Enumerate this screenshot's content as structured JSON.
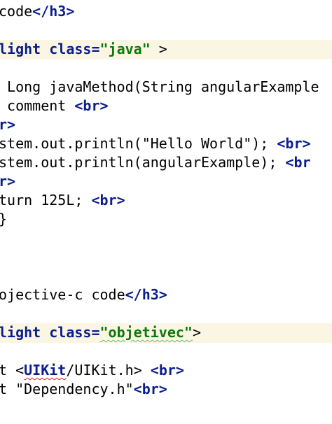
{
  "editor": {
    "lines": {
      "l1": {
        "text": "code",
        "close_tag": "</h3>"
      },
      "l2": {
        "kw": "light",
        "attr": "class=",
        "val": "\"java\"",
        "rest": " >"
      },
      "l3": {
        "text": " Long javaMethod(String angularExample"
      },
      "l4": {
        "text": " comment ",
        "tag": "<br>"
      },
      "l5": {
        "tag": "r>"
      },
      "l6": {
        "text": "stem.out.println(\"Hello World\"); ",
        "tag": "<br>"
      },
      "l7": {
        "text": "stem.out.println(angularExample); ",
        "tag": "<br"
      },
      "l8": {
        "tag": "r>"
      },
      "l9": {
        "text": "turn 125L; ",
        "tag": "<br>"
      },
      "l10": {
        "text": "}"
      },
      "l11": {
        "text": "ojective-c code",
        "close_tag": "</h3>"
      },
      "l12": {
        "kw": "light",
        "attr": "class=",
        "val": "\"objetivec\"",
        "rest": ">"
      },
      "l13": {
        "pre": "t ",
        "open": "<",
        "lib": "UIKit",
        "rest": "/UIKit.h> ",
        "tag": "<br>"
      },
      "l14": {
        "text": "t \"Dependency.h\"",
        "tag": "<br>"
      }
    }
  },
  "colors": {
    "tag": "#0a1e8c",
    "string": "#0a7a0a",
    "highlight_band": "#fbf6e4",
    "spell_error": "#d62020"
  }
}
